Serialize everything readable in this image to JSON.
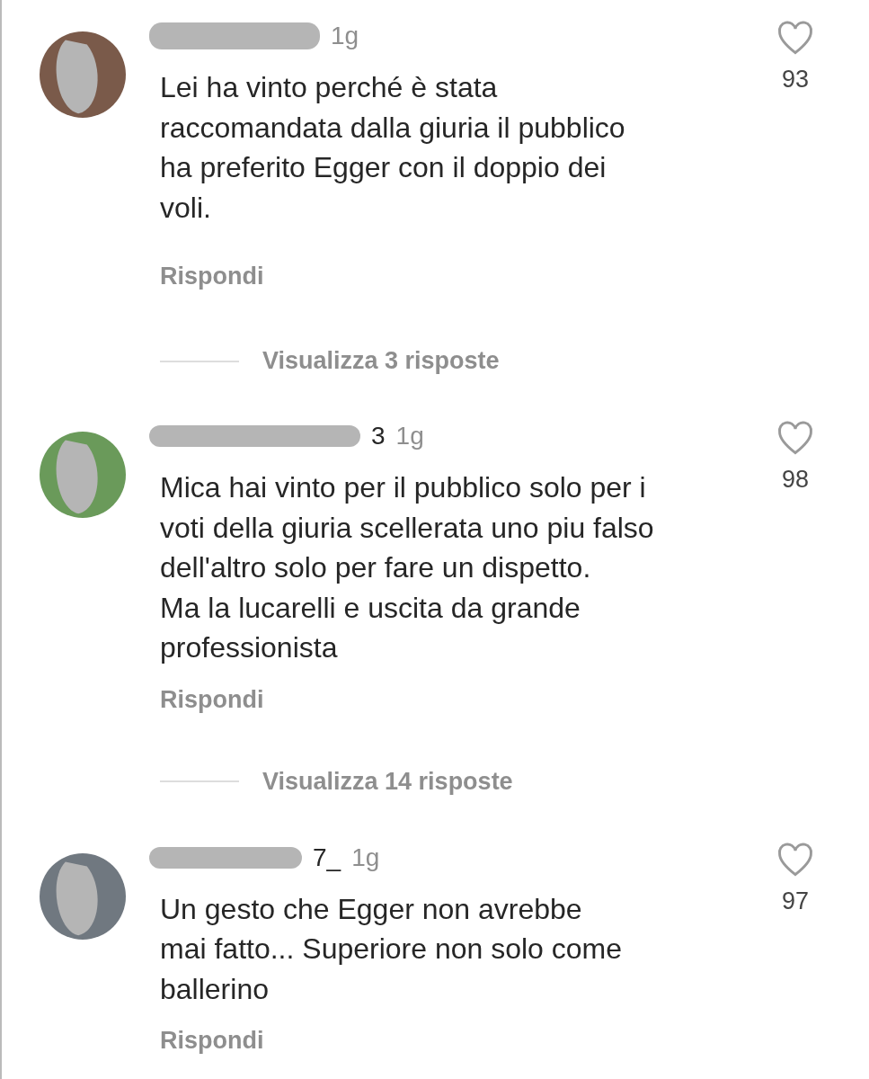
{
  "comments": [
    {
      "time": "1g",
      "text": "Lei ha vinto perché è stata\nraccomandata dalla giuria il pubblico\nha preferito Egger con il doppio dei\nvoli.",
      "likes": "93",
      "reply": "Rispondi",
      "view_replies": "Visualizza 3 risposte"
    },
    {
      "username": "3",
      "time": "1g",
      "text": "Mica hai vinto per il pubblico solo per i\nvoti della giuria scellerata uno piu falso\ndell'altro solo per fare un dispetto.\nMa la lucarelli e uscita da grande\nprofessionista",
      "likes": "98",
      "reply": "Rispondi",
      "view_replies": "Visualizza 14 risposte"
    },
    {
      "username": "7_",
      "time": "1g",
      "text": "Un gesto che Egger non avrebbe\nmai fatto... Superiore non solo come\nballerino",
      "likes": "97",
      "reply": "Rispondi"
    }
  ]
}
